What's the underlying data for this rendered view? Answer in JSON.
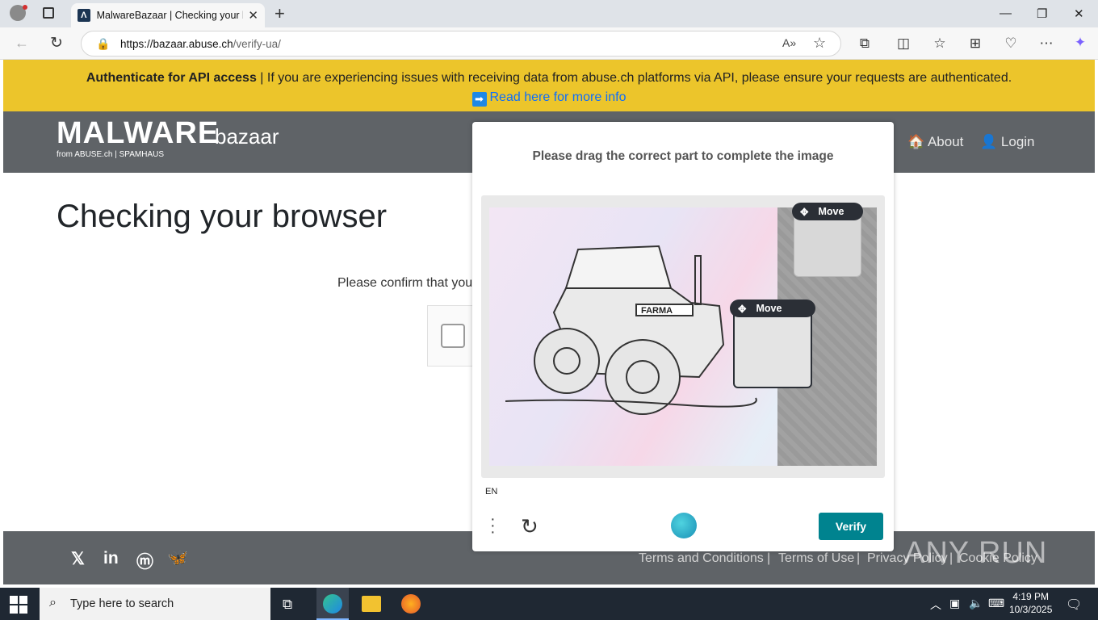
{
  "browser": {
    "tab_title": "MalwareBazaar | Checking your browser",
    "url_host": "https://bazaar.abuse.ch",
    "url_path": "/verify-ua/"
  },
  "banner": {
    "bold": "Authenticate for API access",
    "text": " | If you are experiencing issues with receiving data from abuse.ch platforms via API, please ensure your requests are authenticated.",
    "link": "Read here for more info"
  },
  "nav": {
    "logo_main": "MALWARE",
    "logo_sub": "bazaar",
    "logo_from": "from ABUSE.ch | SPAMHAUS",
    "about": "About",
    "login": "Login"
  },
  "main": {
    "heading": "Checking your browser",
    "confirm": "Please confirm that you"
  },
  "captcha": {
    "prompt": "Please drag the correct part to complete the image",
    "move_label": "Move",
    "lang": "EN",
    "verify": "Verify",
    "brand_text": "FARMA"
  },
  "footer": {
    "links": [
      "Terms and Conditions",
      "Terms of Use",
      "Privacy Policy",
      "Cookie Policy"
    ],
    "watermark": "ANY RUN"
  },
  "taskbar": {
    "search_placeholder": "Type here to search",
    "time": "4:19 PM",
    "date": "10/3/2025"
  },
  "colors": {
    "banner": "#ecc52b",
    "navbar": "#5f6367",
    "verify": "#00838f"
  }
}
